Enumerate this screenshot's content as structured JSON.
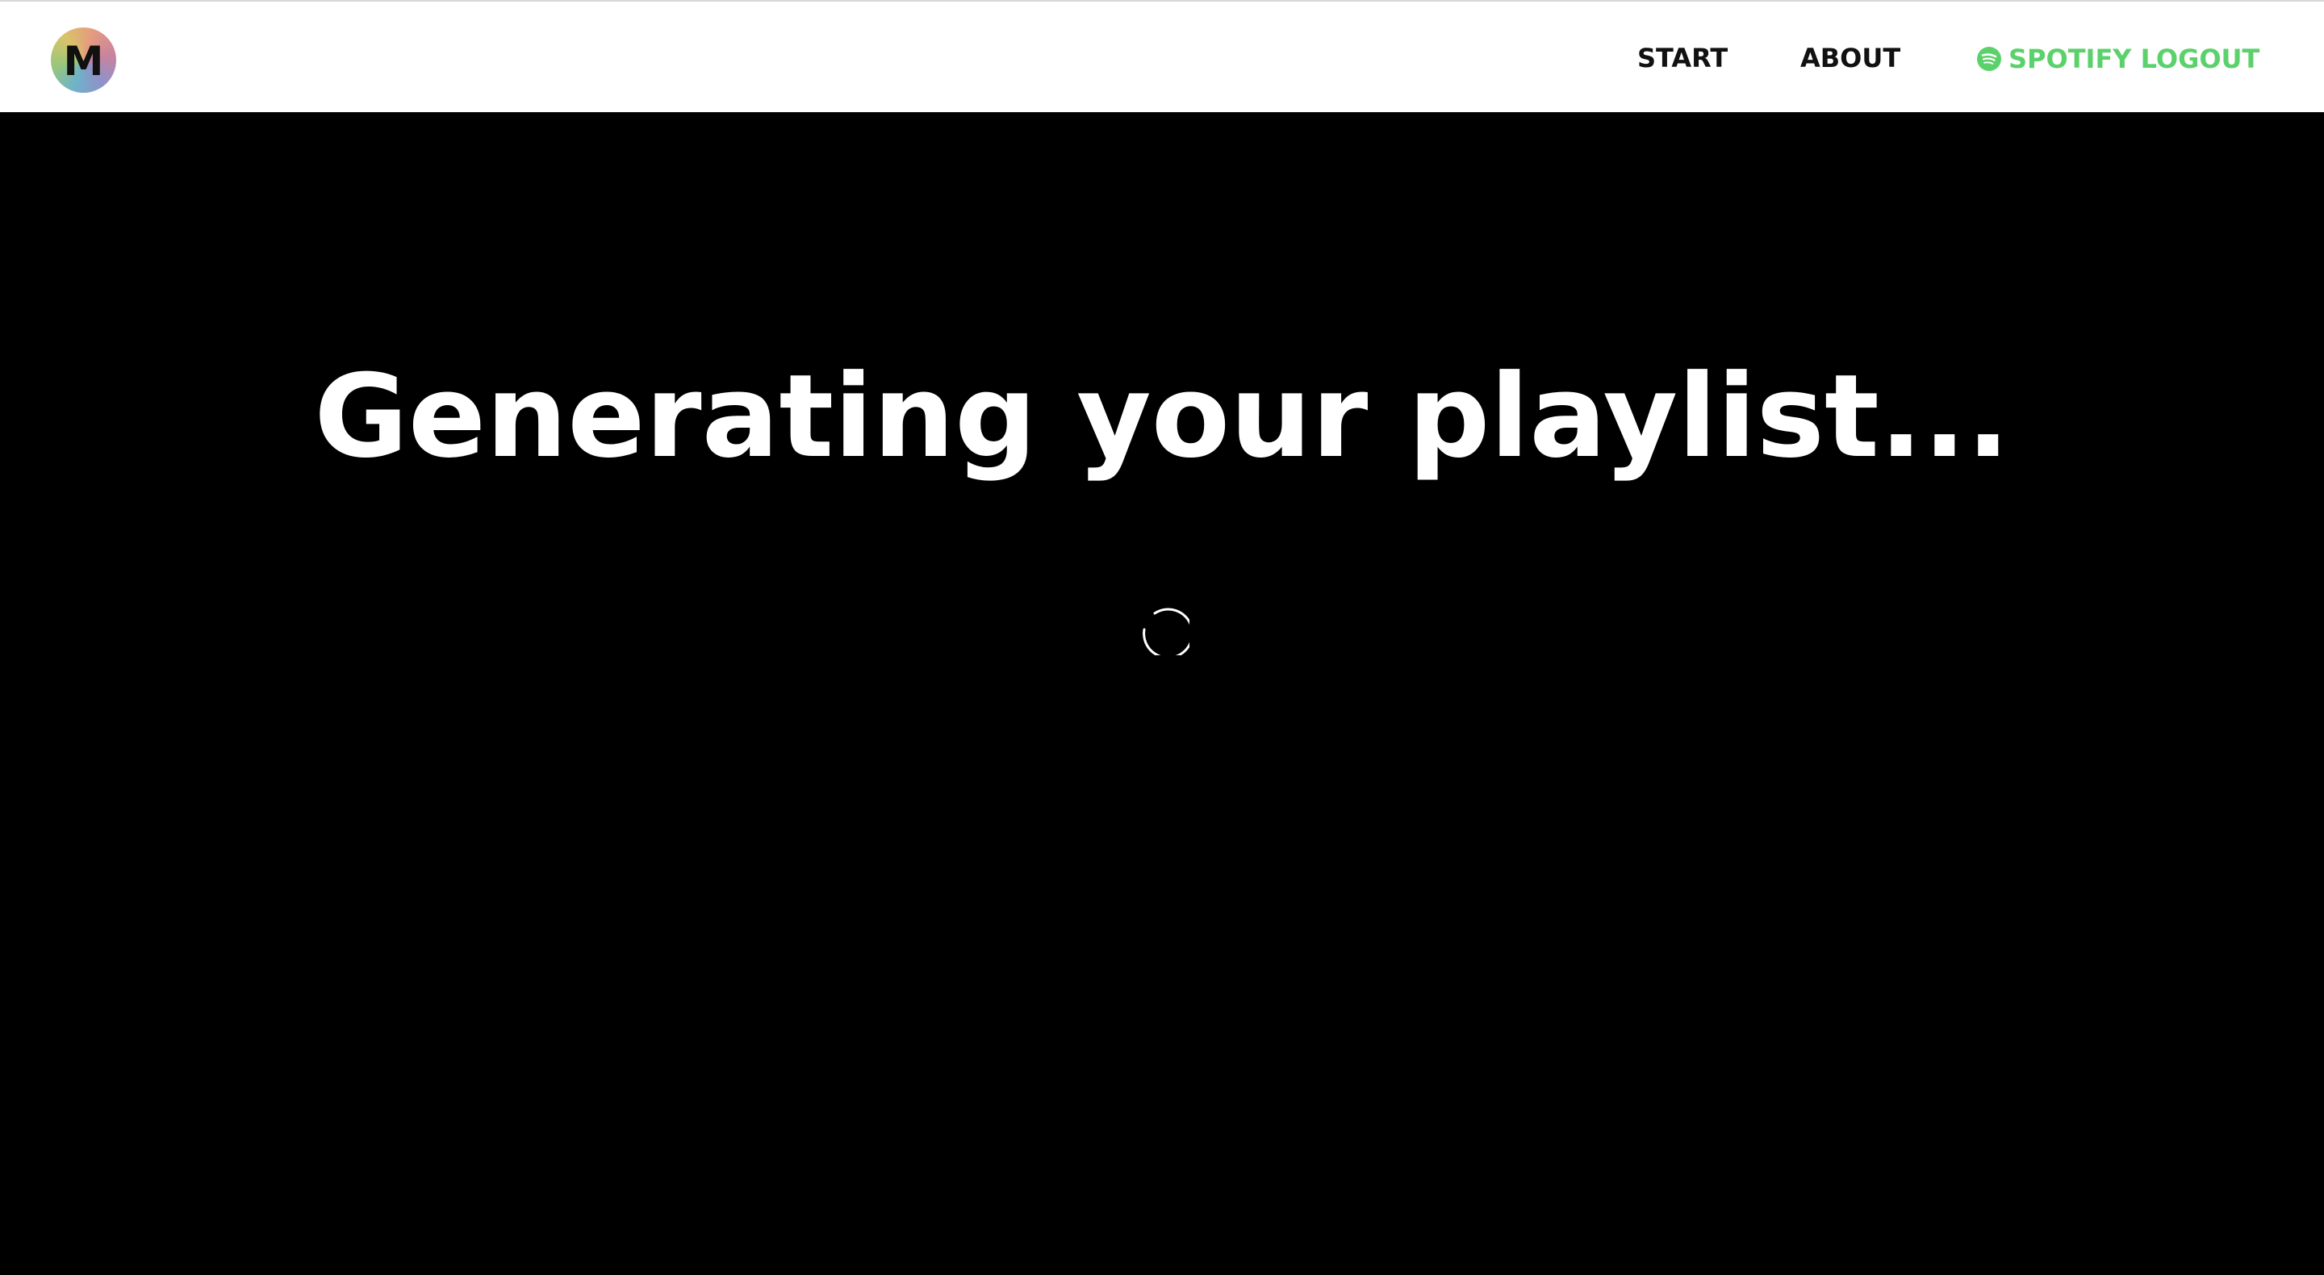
{
  "header": {
    "logo_letter": "M",
    "nav": {
      "start_label": "START",
      "about_label": "ABOUT",
      "logout_label": "SPOTIFY LOGOUT",
      "logout_icon": "spotify-icon"
    }
  },
  "main": {
    "title": "Generating your playlist...",
    "loading_indicator": "spinner-icon"
  },
  "colors": {
    "navbar_background": "#ffffff",
    "page_background": "#000000",
    "nav_text": "#111111",
    "spotify_green": "#5bd16b",
    "title_text": "#ffffff"
  }
}
